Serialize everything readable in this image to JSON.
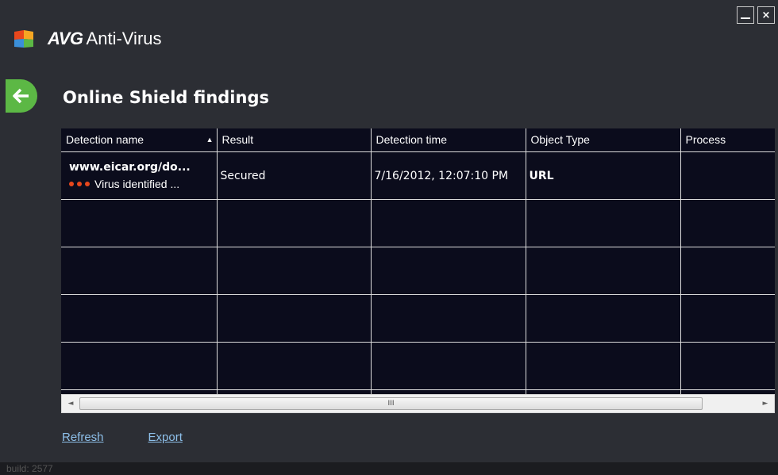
{
  "window": {
    "minimize_label": "",
    "close_label": "×"
  },
  "brand": {
    "name_bold": "AVG",
    "name_rest": "Anti-Virus",
    "logo_icon": "avg-flag-logo"
  },
  "back": {
    "icon": "arrow-left-icon"
  },
  "page_title": "Online Shield findings",
  "table": {
    "sorted_by": "Detection name",
    "sort_direction": "ascending",
    "columns": [
      "Detection name",
      "Result",
      "Detection time",
      "Object Type",
      "Process"
    ],
    "rows": [
      {
        "name": "www.eicar.org/do...",
        "threat": "Virus identified ...",
        "result": "Secured",
        "time": "7/16/2012, 12:07:10 PM",
        "object_type": "URL",
        "process": ""
      }
    ]
  },
  "scrollbar": {
    "left_arrow": "◄",
    "right_arrow": "►",
    "grip": "III"
  },
  "links": {
    "refresh": "Refresh",
    "export": "Export"
  },
  "footer": {
    "build": "build: 2577"
  },
  "colors": {
    "background": "#2c2e34",
    "table_bg": "#0b0c1c",
    "back_button": "#5cb845",
    "threat_dots": "#e8471c",
    "link": "#8ec0ea"
  }
}
